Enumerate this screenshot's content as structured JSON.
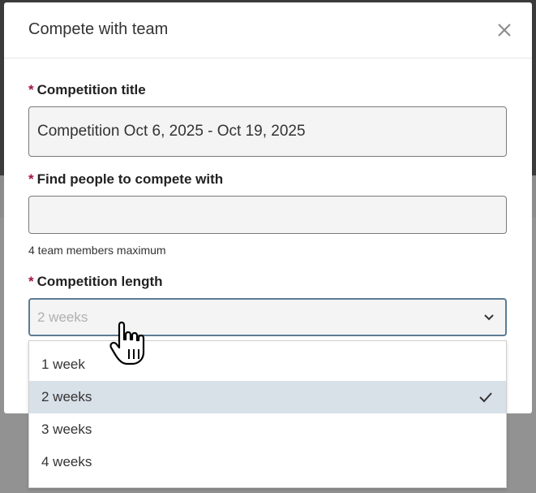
{
  "modal": {
    "title": "Compete with team",
    "close_icon": "close-icon"
  },
  "form": {
    "required_marker": "*",
    "title_field": {
      "label": "Competition title",
      "value": "Competition Oct 6, 2025 - Oct 19, 2025"
    },
    "people_field": {
      "label": "Find people to compete with",
      "value": "",
      "helper": "4 team members maximum"
    },
    "length_field": {
      "label": "Competition length",
      "placeholder": "2 weeks",
      "options": [
        {
          "label": "1 week",
          "selected": false
        },
        {
          "label": "2 weeks",
          "selected": true
        },
        {
          "label": "3 weeks",
          "selected": false
        },
        {
          "label": "4 weeks",
          "selected": false
        }
      ]
    }
  },
  "colors": {
    "required": "#a0124a",
    "selected_option_bg": "#d8e0e8",
    "select_border": "#5b7c94"
  }
}
